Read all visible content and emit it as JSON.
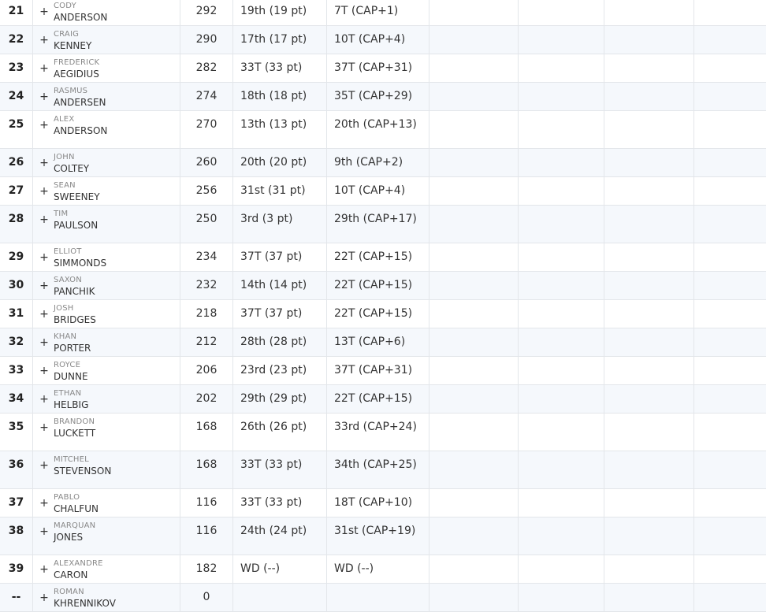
{
  "table": {
    "rows": [
      {
        "pos": "21",
        "first": "Cody",
        "last": "Anderson",
        "total": "292",
        "r1": "19th (19 pt)",
        "r2": "7T (CAP+1)"
      },
      {
        "pos": "22",
        "first": "Craig",
        "last": "Kenney",
        "total": "290",
        "r1": "17th (17 pt)",
        "r2": "10T (CAP+4)"
      },
      {
        "pos": "23",
        "first": "Frederick",
        "last": "Aegidius",
        "total": "282",
        "r1": "33T (33 pt)",
        "r2": "37T (CAP+31)"
      },
      {
        "pos": "24",
        "first": "Rasmus",
        "last": "Andersen",
        "total": "274",
        "r1": "18th (18 pt)",
        "r2": "35T (CAP+29)"
      },
      {
        "pos": "25",
        "first": "Alex",
        "last": "Anderson",
        "total": "270",
        "r1": "13th (13 pt)",
        "r2": "20th (CAP+13)"
      },
      {
        "pos": "26",
        "first": "John",
        "last": "Coltey",
        "total": "260",
        "r1": "20th (20 pt)",
        "r2": "9th (CAP+2)"
      },
      {
        "pos": "27",
        "first": "Sean",
        "last": "Sweeney",
        "total": "256",
        "r1": "31st (31 pt)",
        "r2": "10T (CAP+4)"
      },
      {
        "pos": "28",
        "first": "Tim",
        "last": "Paulson",
        "total": "250",
        "r1": "3rd (3 pt)",
        "r2": "29th (CAP+17)"
      },
      {
        "pos": "29",
        "first": "Elliot",
        "last": "Simmonds",
        "total": "234",
        "r1": "37T (37 pt)",
        "r2": "22T (CAP+15)"
      },
      {
        "pos": "30",
        "first": "Saxon",
        "last": "Panchik",
        "total": "232",
        "r1": "14th (14 pt)",
        "r2": "22T (CAP+15)"
      },
      {
        "pos": "31",
        "first": "Josh",
        "last": "Bridges",
        "total": "218",
        "r1": "37T (37 pt)",
        "r2": "22T (CAP+15)"
      },
      {
        "pos": "32",
        "first": "Khan",
        "last": "Porter",
        "total": "212",
        "r1": "28th (28 pt)",
        "r2": "13T (CAP+6)"
      },
      {
        "pos": "33",
        "first": "Royce",
        "last": "Dunne",
        "total": "206",
        "r1": "23rd (23 pt)",
        "r2": "37T (CAP+31)"
      },
      {
        "pos": "34",
        "first": "Ethan",
        "last": "Helbig",
        "total": "202",
        "r1": "29th (29 pt)",
        "r2": "22T (CAP+15)"
      },
      {
        "pos": "35",
        "first": "Brandon",
        "last": "Luckett",
        "total": "168",
        "r1": "26th (26 pt)",
        "r2": "33rd (CAP+24)"
      },
      {
        "pos": "36",
        "first": "Mitchel",
        "last": "Stevenson",
        "total": "168",
        "r1": "33T (33 pt)",
        "r2": "34th (CAP+25)"
      },
      {
        "pos": "37",
        "first": "Pablo",
        "last": "Chalfun",
        "total": "116",
        "r1": "33T (33 pt)",
        "r2": "18T (CAP+10)"
      },
      {
        "pos": "38",
        "first": "Marquan",
        "last": "Jones",
        "total": "116",
        "r1": "24th (24 pt)",
        "r2": "31st (CAP+19)"
      },
      {
        "pos": "39",
        "first": "Alexandre",
        "last": "Caron",
        "total": "182",
        "r1": "WD (--)",
        "r2": "WD (--)"
      },
      {
        "pos": "--",
        "first": "Roman",
        "last": "Khrennikov",
        "total": "0",
        "r1": "",
        "r2": ""
      }
    ],
    "expand_symbol": "+"
  }
}
